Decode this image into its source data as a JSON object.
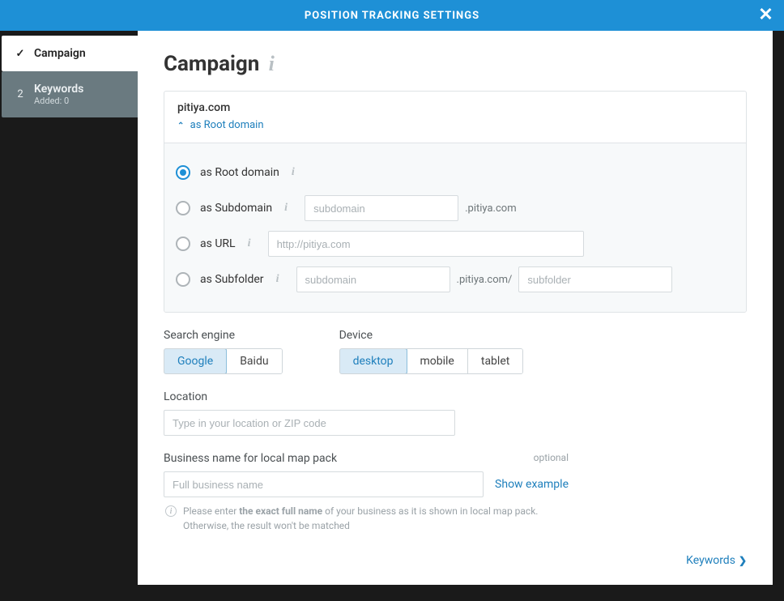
{
  "header": {
    "title": "POSITION TRACKING SETTINGS"
  },
  "steps": {
    "items": [
      {
        "label": "Campaign",
        "ind": "✓"
      },
      {
        "label": "Keywords",
        "ind": "2",
        "sub": "Added: 0"
      }
    ]
  },
  "page": {
    "title": "Campaign"
  },
  "domain": {
    "name": "pitiya.com",
    "toggle_prefix": "as ",
    "toggle_text": "Root domain",
    "suffix": ".pitiya.com",
    "suffix_slash": ".pitiya.com/",
    "options": {
      "root": {
        "label": "as Root domain"
      },
      "subdomain": {
        "label": "as Subdomain",
        "placeholder": "subdomain"
      },
      "url": {
        "label": "as URL",
        "placeholder": "http://pitiya.com"
      },
      "subfolder": {
        "label": "as Subfolder",
        "placeholder_sub": "subdomain",
        "placeholder_folder": "subfolder"
      }
    }
  },
  "engine": {
    "label": "Search engine",
    "items": [
      "Google",
      "Baidu"
    ],
    "active": 0
  },
  "device": {
    "label": "Device",
    "items": [
      "desktop",
      "mobile",
      "tablet"
    ],
    "active": 0
  },
  "location": {
    "label": "Location",
    "placeholder": "Type in your location or ZIP code"
  },
  "business": {
    "label": "Business name for local map pack",
    "optional": "optional",
    "placeholder": "Full business name",
    "example_link": "Show example",
    "hint_pre": "Please enter ",
    "hint_bold": "the exact full name",
    "hint_post": " of your business as it is shown in local map pack. Otherwise, the result won't be matched"
  },
  "next": {
    "label": "Keywords"
  }
}
